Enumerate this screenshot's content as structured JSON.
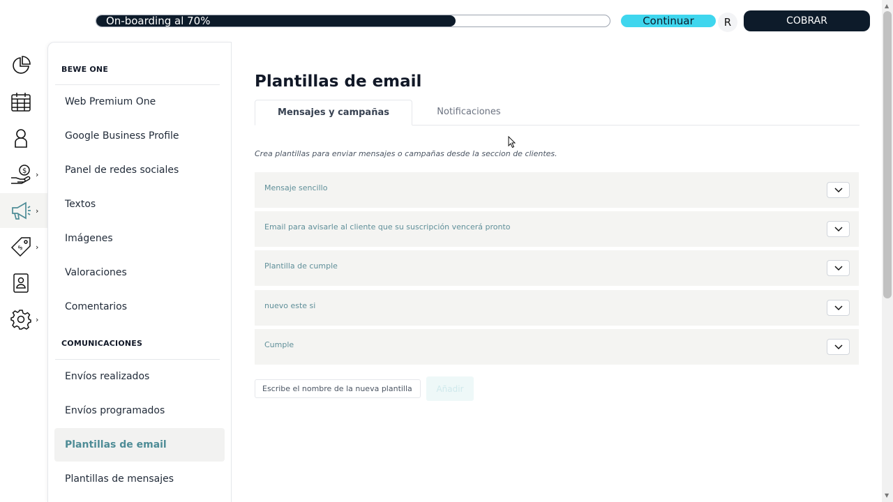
{
  "topbar": {
    "progress_label": "On-boarding al 70%",
    "progress_value": 0.7,
    "continue_label": "Continuar",
    "avatar_initial": "R",
    "cobrar_label": "COBRAR"
  },
  "rail": {
    "icons": [
      "pie-chart-icon",
      "calendar-icon",
      "user-icon",
      "money-hand-icon",
      "megaphone-icon",
      "tag-icon",
      "contact-card-icon",
      "gear-icon"
    ],
    "active_index": 4
  },
  "sidebar": {
    "section1_title": "BEWE ONE",
    "section1_items": [
      "Web Premium One",
      "Google Business Profile",
      "Panel de redes sociales",
      "Textos",
      "Imágenes",
      "Valoraciones",
      "Comentarios"
    ],
    "section2_title": "COMUNICACIONES",
    "section2_items": [
      "Envíos realizados",
      "Envíos programados",
      "Plantillas de email",
      "Plantillas de mensajes"
    ],
    "active_item": "Plantillas de email"
  },
  "main": {
    "title": "Plantillas de email",
    "tabs": [
      {
        "label": "Mensajes y campañas",
        "active": true
      },
      {
        "label": "Notificaciones",
        "active": false
      }
    ],
    "description": "Crea plantillas para enviar mensajes o campañas desde la seccion de clientes.",
    "templates": [
      "Mensaje sencillo",
      "Email para avisarle al cliente que su suscripción vencerá pronto",
      "Plantilla de cumple",
      "nuevo este si",
      "Cumple"
    ],
    "new_placeholder": "Escribe el nombre de la nueva plantilla",
    "add_label": "Añadir"
  },
  "colors": {
    "navy": "#0d1b2a",
    "cyan": "#3fd6ee",
    "teal_text": "#4e8c96",
    "row_bg": "#f4f4f2"
  }
}
